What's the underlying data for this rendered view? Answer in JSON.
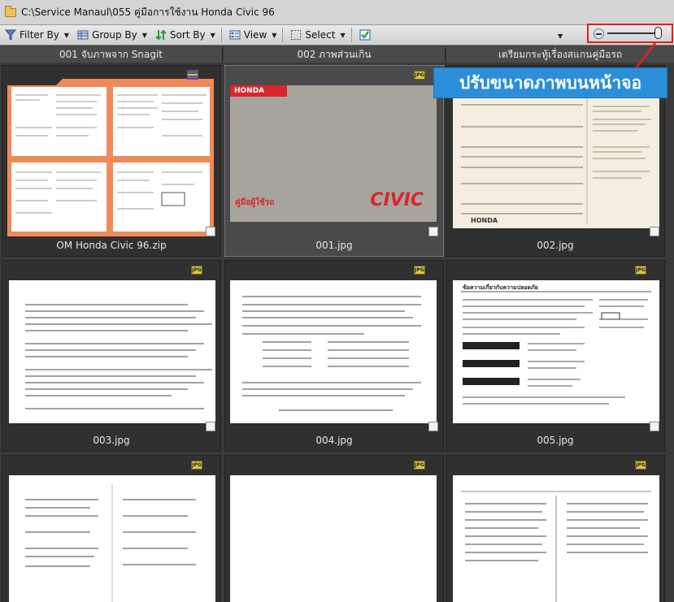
{
  "window": {
    "path": "C:\\Service Manaul\\055 คู่มือการใช้งาน Honda Civic 96"
  },
  "toolbar": {
    "filter_by": "Filter By",
    "group_by": "Group By",
    "sort_by": "Sort By",
    "view": "View",
    "select": "Select"
  },
  "zoom": {
    "level": 1.0
  },
  "groups": [
    "001 จับภาพจาก Snagit",
    "002 ภาพส่วนเกิน",
    "เตรียมกระทู้เรื่องสแกนคู่มือรถ"
  ],
  "items": [
    {
      "label": "OM Honda Civic 96.zip"
    },
    {
      "label": "001.jpg"
    },
    {
      "label": "002.jpg"
    },
    {
      "label": "003.jpg"
    },
    {
      "label": "004.jpg"
    },
    {
      "label": "005.jpg"
    }
  ],
  "badge_text": "JPG",
  "cover": {
    "brand": "HONDA",
    "model": "CIVIC",
    "caption": "คู่มือผู้ใช้รถ"
  },
  "doc005_title": "ข้อความเกี่ยวกับความปลอดภัย",
  "doc002_footer_brand": "HONDA",
  "callout": {
    "text": "ปรับขนาดภาพบนหน้าจอ"
  },
  "colors": {
    "callout": "#2b8ed8",
    "highlight": "#e02020",
    "cover_red": "#d8262c"
  }
}
